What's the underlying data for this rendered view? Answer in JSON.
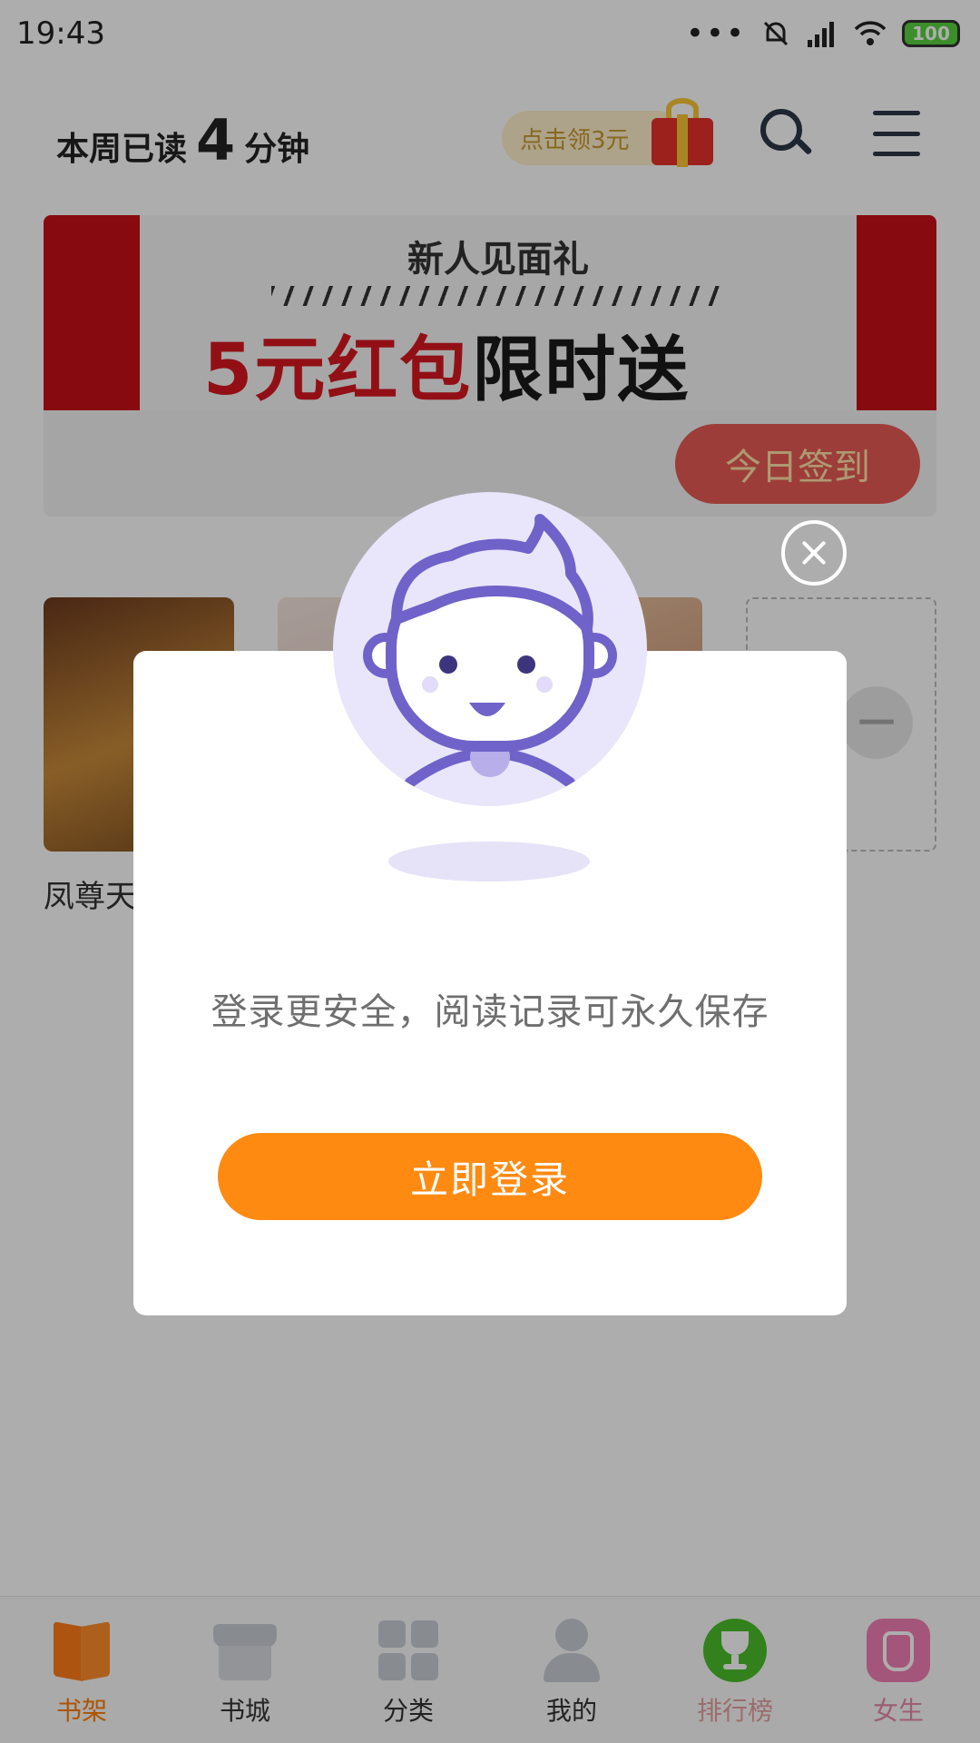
{
  "status_bar": {
    "time": "19:43",
    "dots": "•••",
    "battery": "100"
  },
  "header": {
    "read_prefix": "本周已读",
    "read_minutes": "4",
    "read_suffix": "分钟",
    "coupon_label": "点击领3元",
    "icons": [
      "gift-icon",
      "search-icon",
      "menu-icon"
    ]
  },
  "banner": {
    "subtitle": "新人见面礼",
    "main_red": "5元红包",
    "main_dark": "限时送",
    "checkin_label": "今日签到"
  },
  "shelf": {
    "first_book_title": "凤尊天"
  },
  "bottom_nav": {
    "items": [
      {
        "label": "书架",
        "icon": "bookshelf-icon",
        "active": true
      },
      {
        "label": "书城",
        "icon": "bookstore-icon"
      },
      {
        "label": "分类",
        "icon": "category-icon"
      },
      {
        "label": "我的",
        "icon": "profile-icon"
      },
      {
        "label": "排行榜",
        "icon": "trophy-icon"
      },
      {
        "label": "女生",
        "icon": "dress-icon"
      }
    ]
  },
  "modal": {
    "message": "登录更安全，阅读记录可永久保存",
    "login_label": "立即登录",
    "close_icon": "close-icon",
    "avatar_icon": "user-avatar-icon"
  },
  "colors": {
    "accent": "#ff8a12",
    "banner_red": "#d7191f",
    "checkin_pill": "#e85a55",
    "avatar_bg": "#e9e6fb",
    "avatar_stroke": "#6f63c9"
  }
}
